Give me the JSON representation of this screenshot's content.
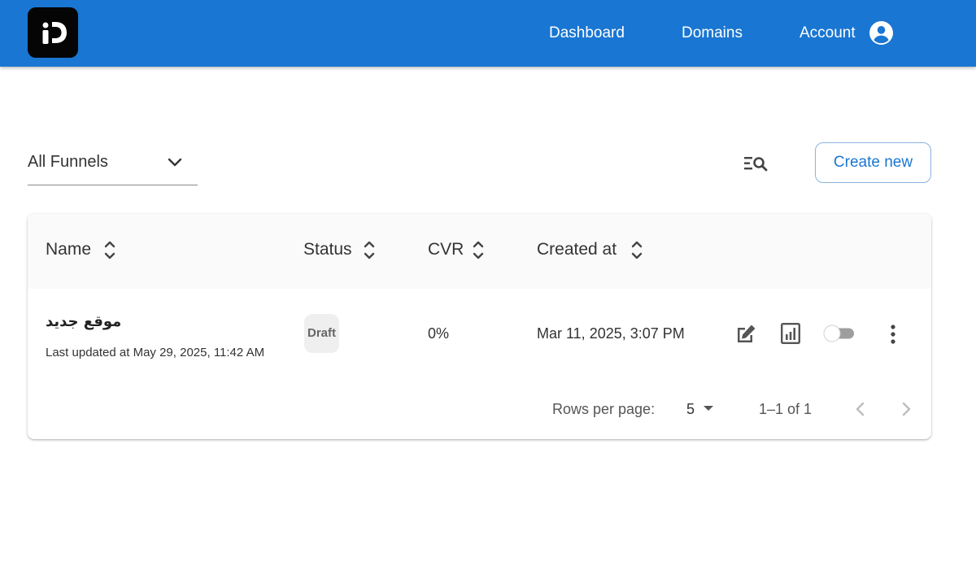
{
  "header": {
    "logo_text": "iD",
    "nav": {
      "dashboard": "Dashboard",
      "domains": "Domains",
      "account": "Account"
    },
    "icons": {
      "account": "account-circle-icon"
    }
  },
  "toolbar": {
    "funnel_filter": "All Funnels",
    "create_label": "Create new",
    "icons": {
      "filter": "chevron-down-icon",
      "search": "list-search-icon"
    }
  },
  "table": {
    "columns": [
      "Name",
      "Status",
      "CVR",
      "Created at"
    ],
    "rows": [
      {
        "name": "موقع جديد",
        "updated": "Last updated at May 29, 2025, 11:42 AM",
        "status": "Draft",
        "cvr": "0%",
        "created": "Mar 11, 2025, 3:07 PM",
        "published": false,
        "actions": [
          "edit-icon",
          "analytics-icon",
          "toggle-switch",
          "more-vert-icon"
        ]
      }
    ]
  },
  "pagination": {
    "rows_label": "Rows per page:",
    "rows_value": "5",
    "range": "1–1 of 1"
  },
  "colors": {
    "primary": "#1976d2",
    "logo_bg": "#050505",
    "chip_bg": "#efefef"
  }
}
